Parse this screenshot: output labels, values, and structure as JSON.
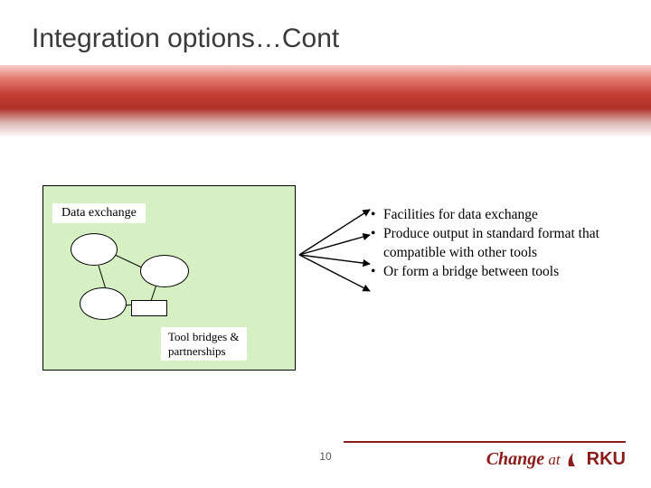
{
  "title": "Integration options…Cont",
  "diagram": {
    "data_exchange_label": "Data exchange",
    "tool_bridges_label": "Tool bridges &\npartnerships"
  },
  "bullets": [
    "Facilities for data exchange",
    "Produce output in standard format that compatible with other tools",
    "Or form a bridge between tools"
  ],
  "page_number": "10",
  "footer": {
    "brand_change": "Change",
    "brand_at": " at ",
    "brand_rku": "RKU"
  }
}
